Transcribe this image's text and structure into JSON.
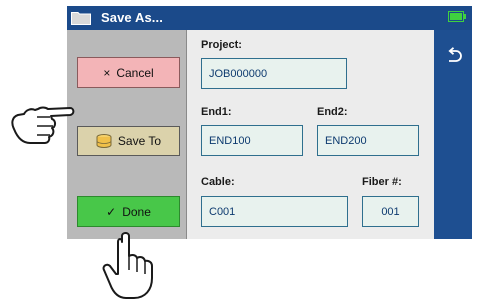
{
  "window": {
    "title": "Save As..."
  },
  "sidebar": {
    "cancel_label": "Cancel",
    "cancel_glyph": "×",
    "save_to_label": "Save To",
    "done_label": "Done",
    "done_glyph": "✓"
  },
  "form": {
    "project": {
      "label": "Project:",
      "value": "JOB000000"
    },
    "end1": {
      "label": "End1:",
      "value": "END100"
    },
    "end2": {
      "label": "End2:",
      "value": "END200"
    },
    "cable": {
      "label": "Cable:",
      "value": "C001"
    },
    "fiber": {
      "label": "Fiber #:",
      "value": "001"
    }
  },
  "icons": [
    "folder-icon",
    "battery-icon",
    "disk-icon",
    "back-arrow-icon",
    "pointing-hand-icon"
  ],
  "colors": {
    "titlebar": "#1b4a8a",
    "accent_blue": "#1e4f91",
    "cancel": "#f3b4b7",
    "save_to": "#dbd2ab",
    "done": "#48c749",
    "battery": "#3fd13f"
  }
}
